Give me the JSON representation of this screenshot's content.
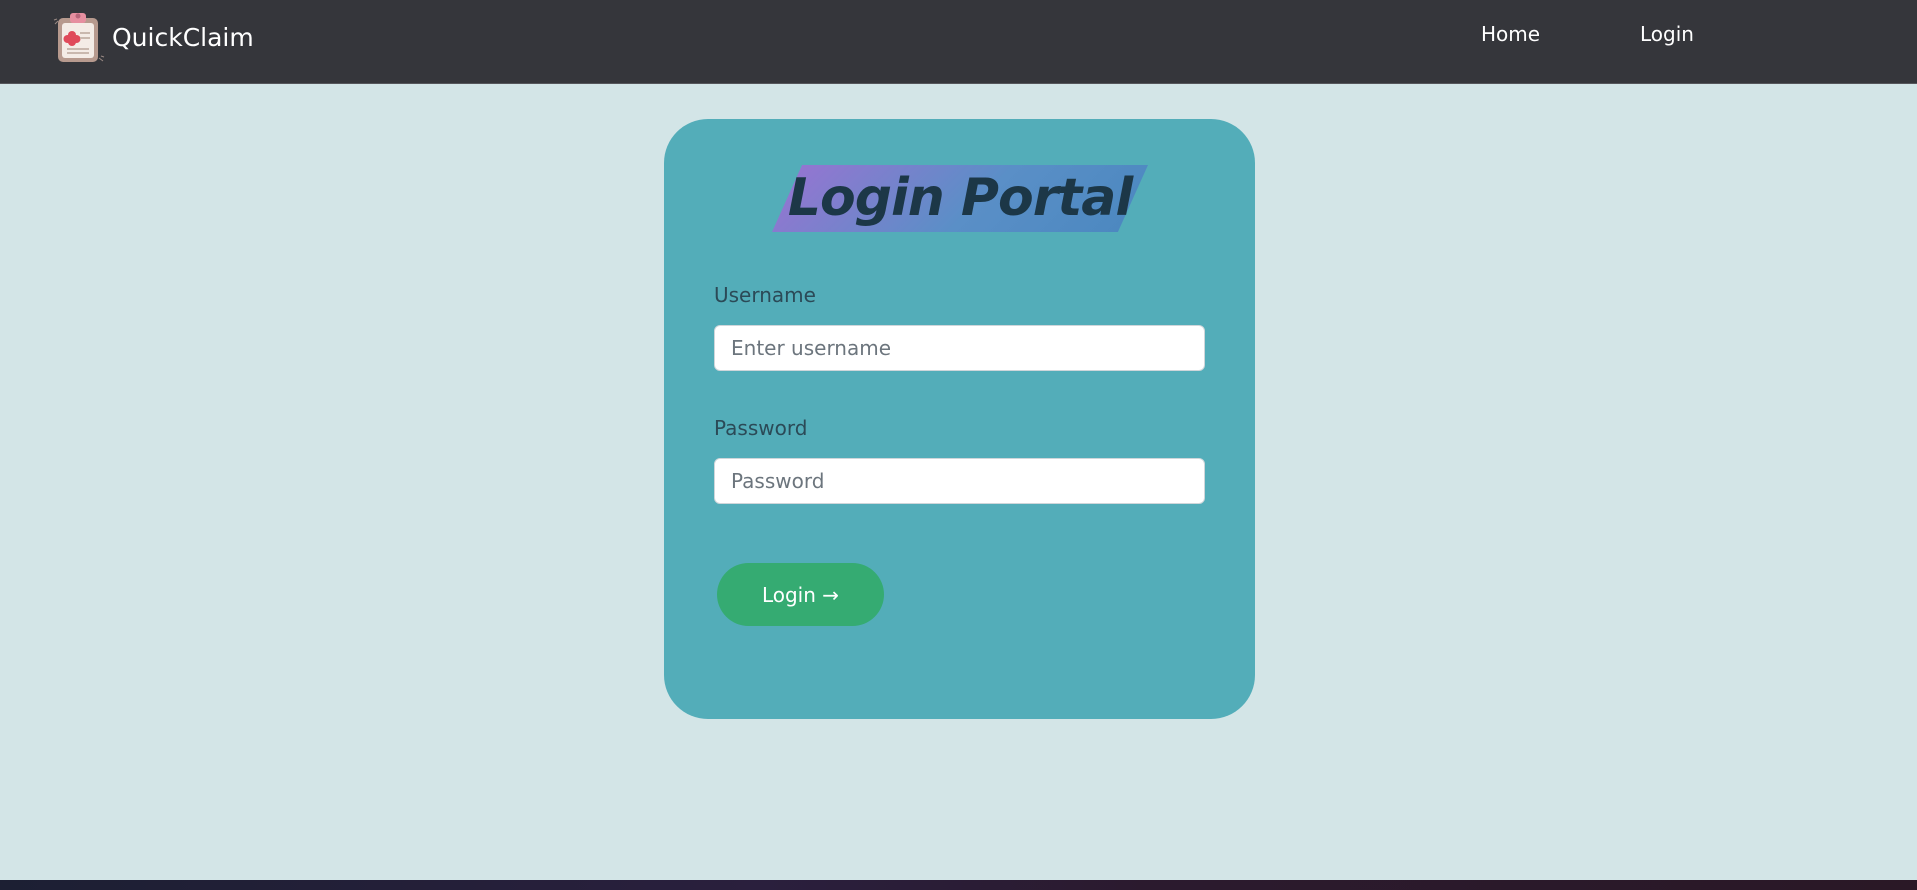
{
  "navbar": {
    "brand_name": "QuickClaim",
    "logo_icon": "clipboard-medical-icon",
    "links": [
      {
        "label": "Home"
      },
      {
        "label": "Login"
      }
    ],
    "background_color": "#35363b"
  },
  "login_card": {
    "title": "Login Portal",
    "username_label": "Username",
    "username_placeholder": "Enter username",
    "username_value": "",
    "password_label": "Password",
    "password_placeholder": "Password",
    "password_value": "",
    "submit_label": "Login →",
    "card_color": "#53adb9",
    "button_color": "#35ab72"
  },
  "page": {
    "background_color": "#d3e5e7"
  }
}
